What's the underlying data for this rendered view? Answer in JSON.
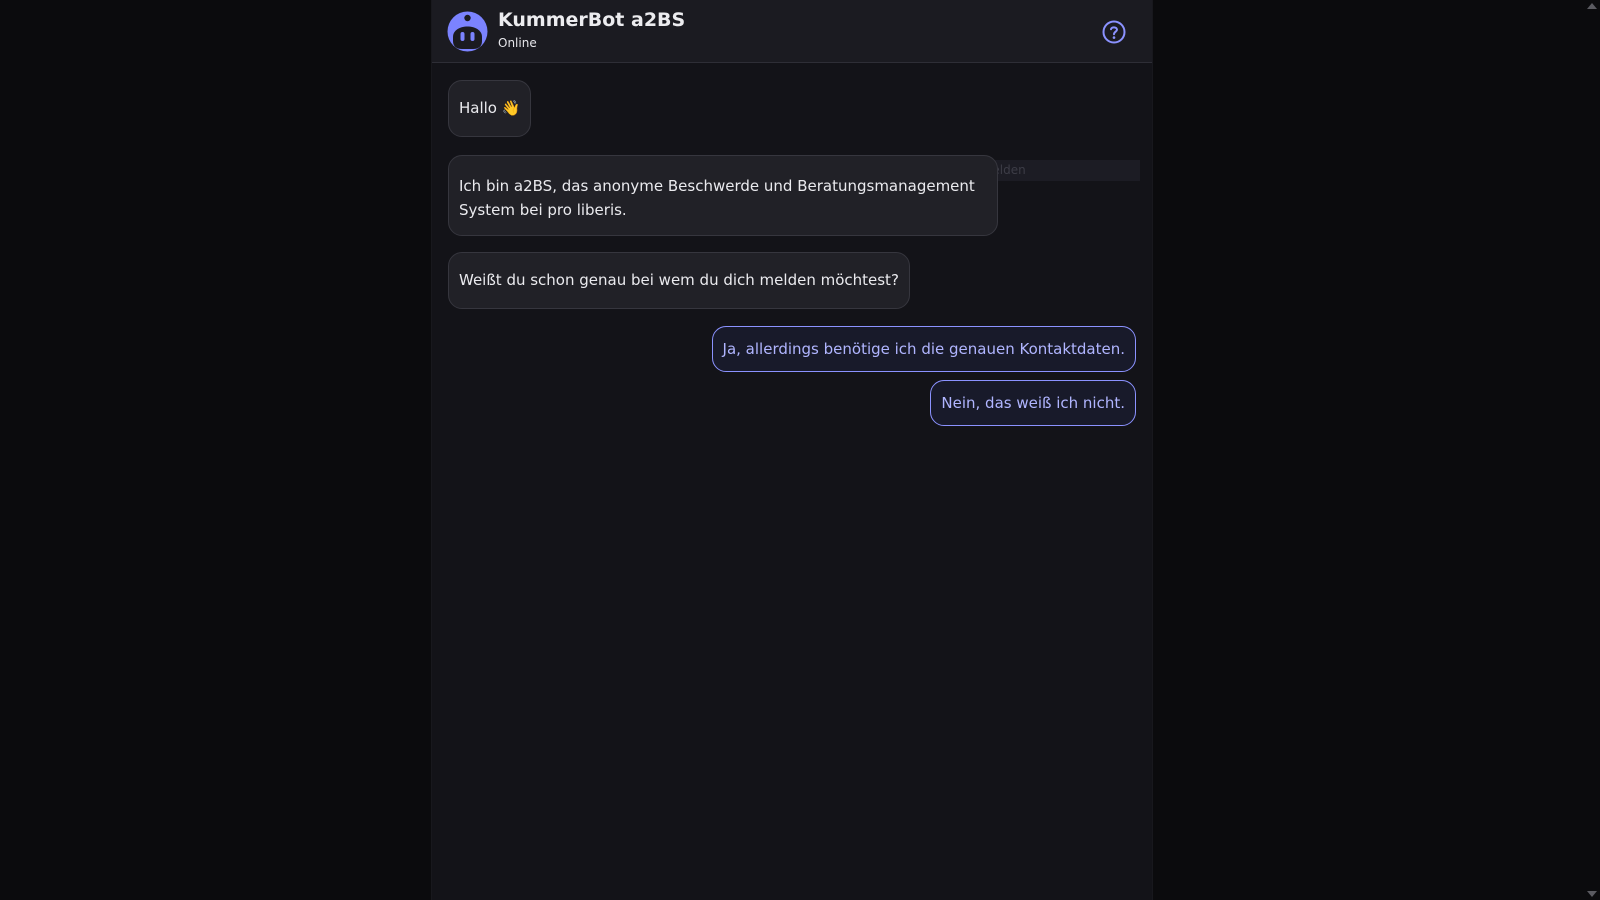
{
  "header": {
    "title": "KummerBot a2BS",
    "status": "Online",
    "avatar_icon": "robot-face-icon",
    "help_icon": "question-circle-icon"
  },
  "messages": {
    "bot": [
      {
        "text": "Hallo 👋"
      },
      {
        "text": "Ich bin a2BS, das anonyme Beschwerde und Beratungsmanagement System bei pro liberis."
      },
      {
        "text": "Weißt du schon genau bei wem du dich melden möchtest?"
      }
    ],
    "options": [
      {
        "text": "Ja, allerdings benötige ich die genauen Kontaktdaten."
      },
      {
        "text": "Nein, das weiß ich nicht."
      }
    ]
  },
  "ghost_overlay": {
    "text": "Fehler melden"
  },
  "colors": {
    "accent": "#7b83ff",
    "page_background": "#0b0b0d",
    "chat_background": "#131318",
    "header_background": "#1b1b21",
    "bot_bubble": "#212127",
    "user_bubble_border": "#8b92ff",
    "user_bubble_text": "#b0b5ff"
  }
}
